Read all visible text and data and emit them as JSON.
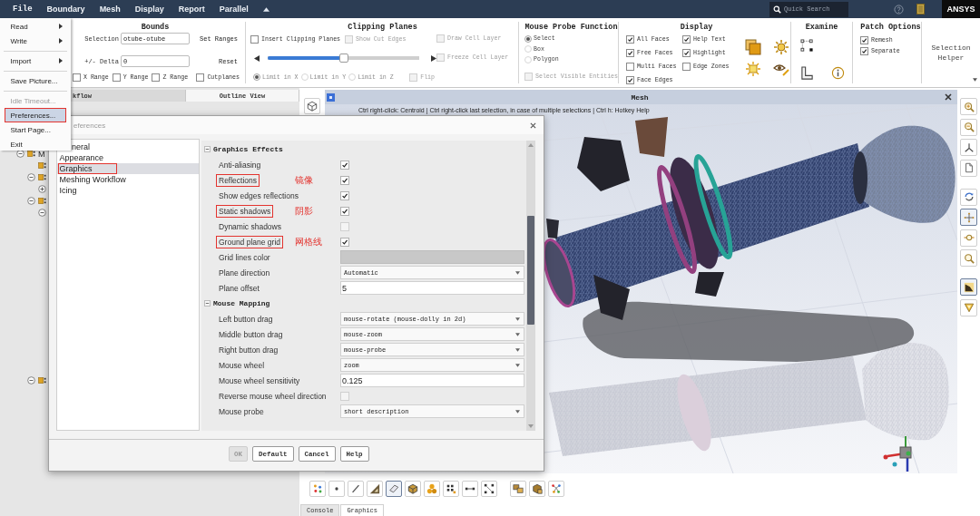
{
  "menubar": {
    "items": [
      "File",
      "Boundary",
      "Mesh",
      "Display",
      "Report",
      "Parallel"
    ],
    "search": {
      "placeholder": "Quick Search"
    },
    "logo": "ANSYS"
  },
  "ribbon": {
    "bounds": {
      "title": "Bounds",
      "selection_label": "Selection",
      "selection_value": "otube-otube",
      "set_ranges_button": "Set Ranges",
      "delta_label": "+/- Delta",
      "delta_value": "0",
      "reset_button": "Reset",
      "ranges": [
        {
          "label": "X Range",
          "checked": false
        },
        {
          "label": "Y Range",
          "checked": false
        },
        {
          "label": "Z Range",
          "checked": false
        },
        {
          "label": "Cutplanes",
          "checked": false
        }
      ]
    },
    "clipping_planes": {
      "title": "Clipping Planes",
      "insert": {
        "label": "Insert Clipping Planes",
        "checked": false,
        "disabled": false
      },
      "show_cut_edges": {
        "label": "Show Cut Edges",
        "checked": false,
        "disabled": true
      },
      "draw_cell_layer": {
        "label": "Draw Cell Layer",
        "checked": false,
        "disabled": true
      },
      "freeze_cell_layer": {
        "label": "Freeze Cell Layer",
        "checked": false,
        "disabled": true
      },
      "slider": {
        "level": 0.5
      },
      "limits": {
        "disabled": true,
        "options": [
          {
            "label": "Limit in X",
            "selected": true
          },
          {
            "label": "Limit in Y",
            "selected": false
          },
          {
            "label": "Limit in Z",
            "selected": false
          }
        ]
      },
      "flip": {
        "label": "Flip",
        "checked": false,
        "disabled": true
      }
    },
    "mouse_probe": {
      "title": "Mouse Probe Function",
      "modes": [
        {
          "label": "Select",
          "selected": true
        },
        {
          "label": "Box",
          "selected": false
        },
        {
          "label": "Polygon",
          "selected": false
        }
      ],
      "select_visible": {
        "label": "Select Visible Entities",
        "checked": false,
        "disabled": true
      }
    },
    "display": {
      "title": "Display",
      "options": [
        {
          "label": "All Faces",
          "checked": true
        },
        {
          "label": "Help Text",
          "checked": true
        },
        {
          "label": "Free Faces",
          "checked": true
        },
        {
          "label": "Highlight",
          "checked": true
        },
        {
          "label": "Multi Faces",
          "checked": false
        },
        {
          "label": "Edge Zones",
          "checked": false
        },
        {
          "label": "Face Edges",
          "checked": true
        }
      ]
    },
    "examine": {
      "title": "Examine"
    },
    "patch_options": {
      "title": "Patch Options",
      "options": [
        {
          "label": "Remesh",
          "checked": true
        },
        {
          "label": "Separate",
          "checked": true
        }
      ]
    },
    "selection_helper": {
      "label": "Selection Helper"
    }
  },
  "left_panel": {
    "tabs": [
      {
        "label": "kflow",
        "selected": false
      },
      {
        "label": "Outline View",
        "selected": true
      }
    ],
    "tree": [
      {
        "kind": "folder",
        "label": "M",
        "expanded": true,
        "children": [
          {
            "kind": "item"
          },
          {
            "kind": "folder",
            "expanded": true,
            "children": [
              {
                "kind": "folder",
                "expanded": false
              }
            ]
          },
          {
            "kind": "folder",
            "expanded": true,
            "children": [
              {
                "kind": "folder",
                "expanded": true
              }
            ]
          },
          {
            "kind": "folder",
            "expanded": true
          }
        ]
      }
    ]
  },
  "graphics": {
    "title": "Mesh",
    "hint": "Ctrl right-click: Centroid | Ctrl right-click last selection, in case of multiple selections | Ctrl h: Hotkey Help"
  },
  "right_toolbar": {
    "groups": [
      [
        {
          "kind": "zoom-in",
          "selected": false
        },
        {
          "kind": "zoom-out",
          "selected": false
        },
        {
          "kind": "axes",
          "selected": false
        },
        {
          "kind": "page",
          "selected": false
        }
      ],
      [
        {
          "kind": "rotate",
          "selected": false
        },
        {
          "kind": "pan",
          "selected": true
        },
        {
          "kind": "zoom-drag",
          "selected": false
        },
        {
          "kind": "magnify",
          "selected": false
        }
      ],
      [
        {
          "kind": "shade",
          "selected": true
        },
        {
          "kind": "funnel",
          "selected": false
        }
      ]
    ]
  },
  "graphics_toolbar": {
    "groups": [
      [
        {
          "kind": "scatter",
          "selected": false
        },
        {
          "kind": "point",
          "selected": false
        },
        {
          "kind": "line",
          "selected": false
        },
        {
          "kind": "triangle",
          "selected": false
        },
        {
          "kind": "face",
          "selected": true
        },
        {
          "kind": "cube",
          "selected": false
        },
        {
          "kind": "blobs",
          "selected": false
        },
        {
          "kind": "grid-dots",
          "selected": false
        },
        {
          "kind": "edge",
          "selected": false
        },
        {
          "kind": "corners",
          "selected": false
        }
      ],
      [
        {
          "kind": "box-pair",
          "selected": false
        },
        {
          "kind": "box-stack",
          "selected": false
        },
        {
          "kind": "network",
          "selected": false
        }
      ]
    ]
  },
  "bottom_tabs": [
    {
      "label": "Console",
      "selected": false
    },
    {
      "label": "Graphics",
      "selected": true
    }
  ],
  "preferences": {
    "title": "eferences",
    "categories": [
      {
        "label": "neral",
        "selected": false,
        "annotated": false
      },
      {
        "label": "Appearance",
        "selected": false,
        "annotated": false
      },
      {
        "label": "Graphics",
        "selected": true,
        "annotated": true
      },
      {
        "label": "Meshing Workflow",
        "selected": false,
        "annotated": false
      },
      {
        "label": "Icing",
        "selected": false,
        "annotated": false
      }
    ],
    "sections": [
      {
        "title": "Graphics Effects",
        "expanded": true,
        "rows": [
          {
            "label": "Anti-aliasing",
            "kind": "checkbox",
            "checked": true,
            "annotated": false
          },
          {
            "label": "Reflections",
            "kind": "checkbox",
            "checked": true,
            "annotated": true,
            "note": "镜像"
          },
          {
            "label": "Show edges reflections",
            "kind": "checkbox",
            "checked": true,
            "annotated": false
          },
          {
            "label": "Static shadows",
            "kind": "checkbox",
            "checked": true,
            "annotated": true,
            "note": "阴影"
          },
          {
            "label": "Dynamic shadows",
            "kind": "checkbox",
            "checked": false,
            "annotated": false
          },
          {
            "label": "Ground plane grid",
            "kind": "checkbox",
            "checked": true,
            "annotated": true,
            "note": "网格线"
          },
          {
            "label": "Grid lines color",
            "kind": "color",
            "color": "#c8c8c8",
            "annotated": false
          },
          {
            "label": "Plane direction",
            "kind": "dropdown",
            "value": "Automatic",
            "annotated": false
          },
          {
            "label": "Plane offset",
            "kind": "text",
            "value": "5",
            "annotated": false
          }
        ]
      },
      {
        "title": "Mouse Mapping",
        "expanded": true,
        "rows": [
          {
            "label": "Left button drag",
            "kind": "dropdown",
            "value": "mouse-rotate (mouse-dolly in 2d)",
            "annotated": false
          },
          {
            "label": "Middle button drag",
            "kind": "dropdown",
            "value": "mouse-zoom",
            "annotated": false
          },
          {
            "label": "Right button drag",
            "kind": "dropdown",
            "value": "mouse-probe",
            "annotated": false
          },
          {
            "label": "Mouse wheel",
            "kind": "dropdown",
            "value": "zoom",
            "annotated": false
          },
          {
            "label": "Mouse wheel sensitivity",
            "kind": "text",
            "value": "0.125",
            "annotated": false
          },
          {
            "label": "Reverse mouse wheel direction",
            "kind": "checkbox",
            "checked": false,
            "annotated": false
          },
          {
            "label": "Mouse probe",
            "kind": "dropdown",
            "value": "short description",
            "annotated": false
          }
        ]
      }
    ],
    "buttons": [
      {
        "label": "OK",
        "disabled": true
      },
      {
        "label": "Default",
        "disabled": false
      },
      {
        "label": "Cancel",
        "disabled": false
      },
      {
        "label": "Help",
        "disabled": false
      }
    ]
  },
  "file_menu": {
    "groups": [
      [
        {
          "label": "Read",
          "submenu": true,
          "disabled": false,
          "highlighted": false,
          "annotated": false
        },
        {
          "label": "Write",
          "submenu": true,
          "disabled": false,
          "highlighted": false,
          "annotated": false
        }
      ],
      [
        {
          "label": "Import",
          "submenu": true,
          "disabled": false,
          "highlighted": false,
          "annotated": false
        }
      ],
      [
        {
          "label": "Save Picture...",
          "submenu": false,
          "disabled": false,
          "highlighted": false,
          "annotated": false
        }
      ],
      [
        {
          "label": "Idle Timeout...",
          "submenu": false,
          "disabled": true,
          "highlighted": false,
          "annotated": false
        },
        {
          "label": "Preferences...",
          "submenu": false,
          "disabled": false,
          "highlighted": true,
          "annotated": true
        },
        {
          "label": "Start Page...",
          "submenu": false,
          "disabled": false,
          "highlighted": false,
          "annotated": false
        },
        {
          "label": "Exit",
          "submenu": false,
          "disabled": false,
          "highlighted": false,
          "annotated": false
        }
      ]
    ]
  }
}
